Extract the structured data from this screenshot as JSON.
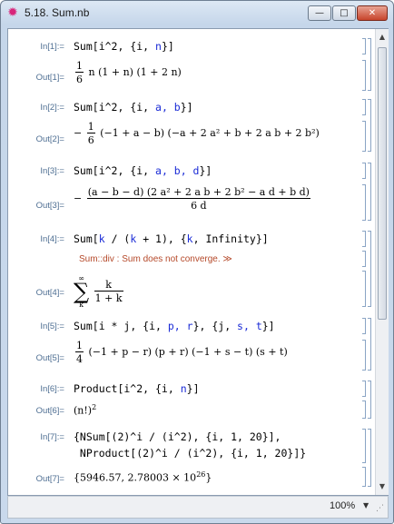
{
  "window": {
    "title": "5.18. Sum.nb",
    "icon": "mathematica-star-icon",
    "buttons": {
      "minimize": "—",
      "maximize": "□",
      "close": "✕"
    }
  },
  "cells": [
    {
      "in_label": "In[1]:=",
      "in_code": [
        [
          "Sum[i^2, {i, ",
          "n",
          "}]"
        ]
      ],
      "out_label": "Out[1]="
    },
    {
      "in_label": "In[2]:=",
      "in_code": [
        [
          "Sum[i^2, {i, ",
          "a, b",
          "}]"
        ]
      ],
      "out_label": "Out[2]="
    },
    {
      "in_label": "In[3]:=",
      "in_code": [
        [
          "Sum[i^2, {i, ",
          "a, b, d",
          "}]"
        ]
      ],
      "out_label": "Out[3]="
    },
    {
      "in_label": "In[4]:=",
      "in_code": [
        [
          "Sum[",
          "k",
          " / (",
          "k",
          " + 1), {",
          "k",
          ", Infinity}]"
        ]
      ],
      "out_label": "Out[4]=",
      "message": "Sum::div :  Sum does not converge. ≫"
    },
    {
      "in_label": "In[5]:=",
      "in_code": [
        [
          "Sum[i ",
          "*",
          " j, {i, ",
          "p, r",
          "}, {j, ",
          "s, t",
          "}]"
        ]
      ],
      "out_label": "Out[5]="
    },
    {
      "in_label": "In[6]:=",
      "in_code": [
        [
          "Product[i^2, {i, ",
          "n",
          "}]"
        ]
      ],
      "out_label": "Out[6]="
    },
    {
      "in_label": "In[7]:=",
      "in_code_line1": "{NSum[(2)^i / (i^2), {i, 1, 20}],",
      "in_code_line2": " NProduct[(2)^i / (i^2), {i, 1, 20}]}",
      "out_label": "Out[7]="
    }
  ],
  "outputs": {
    "out1": {
      "num": "1",
      "den": "6",
      "rest": "n (1 + n) (1 + 2 n)"
    },
    "out2": {
      "sign": "−",
      "num": "1",
      "den": "6",
      "rest": "(−1 + a − b) (−a + 2 a² + b + 2 a b + 2 b²)"
    },
    "out3": {
      "sign": "−",
      "num": "(a − b − d) (2 a² + 2 a b + 2 b² − a d + b d)",
      "den": "6 d"
    },
    "out4": {
      "sum_upper": "∞",
      "sum_symbol": "∑",
      "sum_lower": "k",
      "num": "k",
      "den": "1 + k"
    },
    "out5": {
      "num": "1",
      "den": "4",
      "rest": "(−1 + p − r) (p + r) (−1 + s − t) (s + t)"
    },
    "out6": {
      "text": "(n!)",
      "sup": "2"
    },
    "out7": {
      "text": "{5946.57, 2.78003 × 10",
      "sup": "26",
      "close": "}"
    }
  },
  "statusbar": {
    "zoom": "100%",
    "zoom_arrow": "▼"
  },
  "scrollbar": {
    "up": "▲",
    "down": "▼"
  }
}
